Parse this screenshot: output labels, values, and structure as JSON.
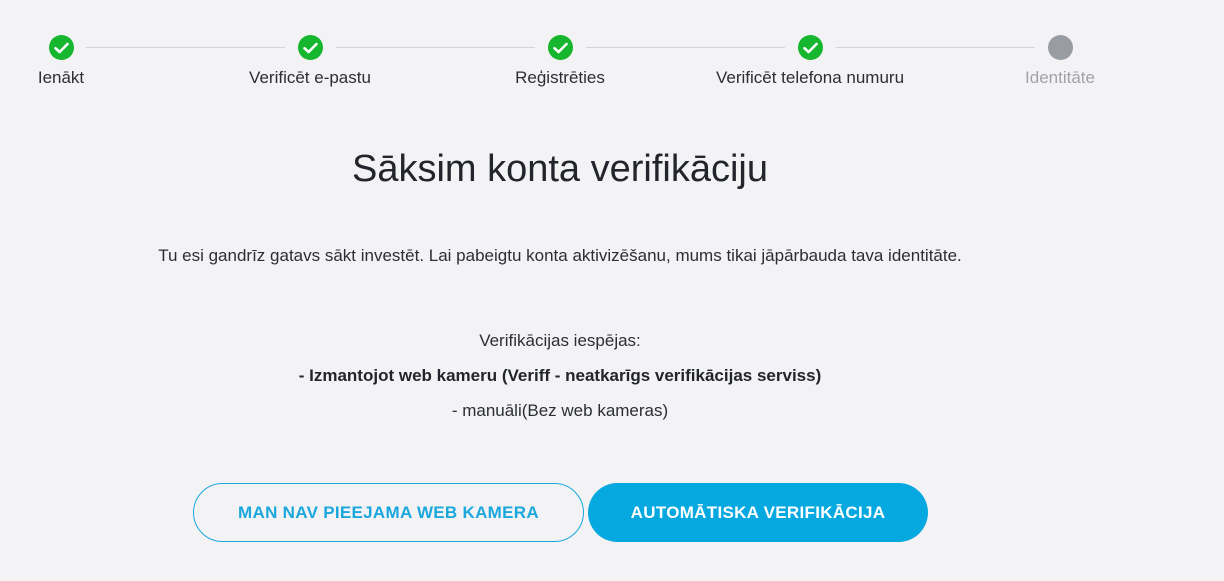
{
  "stepper": {
    "steps": [
      {
        "label": "Ienākt",
        "status": "done"
      },
      {
        "label": "Verificēt e-pastu",
        "status": "done"
      },
      {
        "label": "Reģistrēties",
        "status": "done"
      },
      {
        "label": "Verificēt telefona numuru",
        "status": "done"
      },
      {
        "label": "Identitāte",
        "status": "pending"
      }
    ]
  },
  "main": {
    "title": "Sāksim konta verifikāciju",
    "intro": "Tu esi gandrīz gatavs sākt investēt. Lai pabeigtu konta aktivizēšanu, mums tikai jāpārbauda tava identitāte.",
    "options_heading": "Verifikācijas iespējas:",
    "option_webcam": "- Izmantojot web kameru (Veriff - neatkarīgs verifikācijas serviss)",
    "option_manual": "- manuāli(Bez web kameras)"
  },
  "actions": {
    "no_webcam_label": "MAN NAV PIEEJAMA WEB KAMERA",
    "auto_verify_label": "AUTOMĀTISKA VERIFIKĀCIJA"
  },
  "colors": {
    "accent": "#06a8e0",
    "step_done": "#16b62e",
    "step_pending": "#9a9ca3",
    "background": "#f3f3f5"
  }
}
